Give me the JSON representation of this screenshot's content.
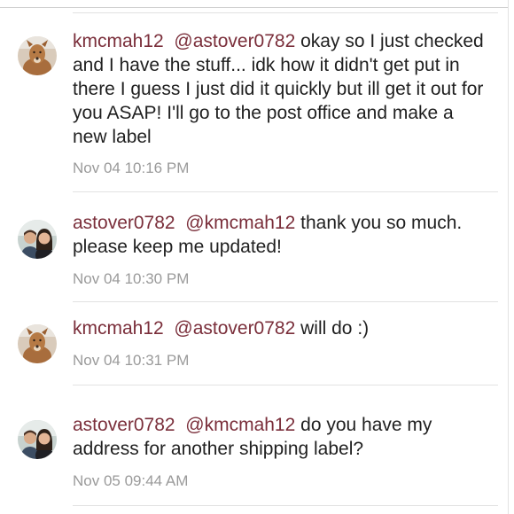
{
  "comments": [
    {
      "user": "kmcmah12",
      "mention": "@astover0782",
      "text": "okay so I just checked and I have the stuff... idk how it didn't get put in there I guess I just did it quickly but ill get it out for you ASAP! I'll go to the post office and make a new label",
      "time": "Nov 04 10:16 PM",
      "avatar_icon": "dog-avatar-icon"
    },
    {
      "user": "astover0782",
      "mention": "@kmcmah12",
      "text": "thank you so much. please keep me updated!",
      "time": "Nov 04 10:30 PM",
      "avatar_icon": "couple-avatar-icon"
    },
    {
      "user": "kmcmah12",
      "mention": "@astover0782",
      "text": "will do :)",
      "time": "Nov 04 10:31 PM",
      "avatar_icon": "dog-avatar-icon"
    },
    {
      "user": "astover0782",
      "mention": "@kmcmah12",
      "text": "do you have my address for another shipping label?",
      "time": "Nov 05 09:44 AM",
      "avatar_icon": "couple-avatar-icon"
    }
  ],
  "colors": {
    "username": "#7a2e3a",
    "mention": "#7a2e3a",
    "text": "#1f1f1f",
    "timestamp": "#9a9a9a",
    "separator": "#e2e2e2"
  }
}
